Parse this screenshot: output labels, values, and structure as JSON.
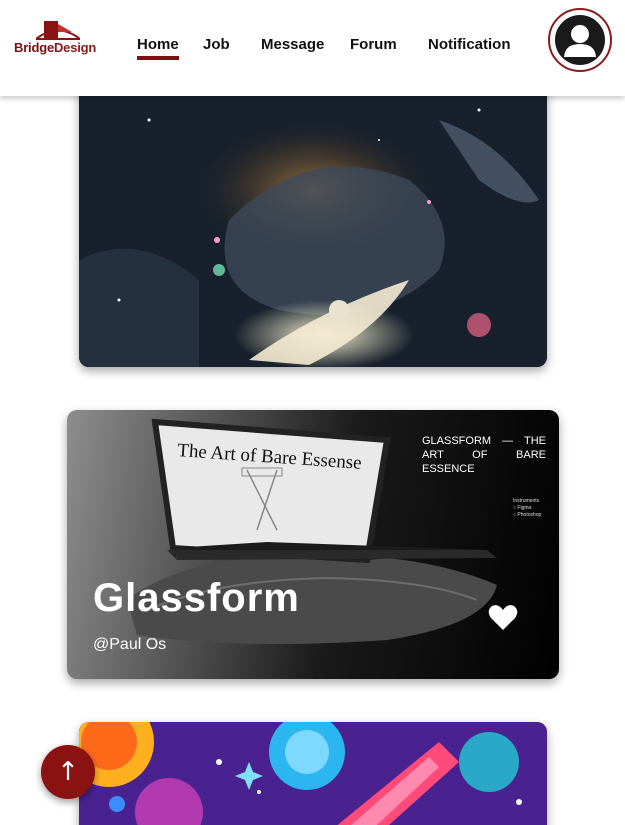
{
  "brand": {
    "name_part1": "Bridge",
    "name_part2": "Design"
  },
  "nav": {
    "items": [
      {
        "label": "Home",
        "active": true
      },
      {
        "label": "Job",
        "active": false
      },
      {
        "label": "Message",
        "active": false
      },
      {
        "label": "Forum",
        "active": false
      },
      {
        "label": "Notification",
        "active": false
      }
    ]
  },
  "header": {
    "avatar_icon": "user-icon"
  },
  "feed": {
    "cards": [
      {
        "title": "",
        "author": "",
        "image": "night-sky-whale-illustration"
      },
      {
        "title": "Glassform",
        "author": "@Paul Os",
        "image": "laptop-on-rock-mockup",
        "heading": "GLASSFORM — THE ART OF BARE ESSENCE",
        "screen_text": "The Art of Bare Essense",
        "instruments_label": "Instruments",
        "instruments": [
          "Figma",
          "Photoshop"
        ],
        "like_icon": "heart-icon"
      },
      {
        "title": "",
        "author": "",
        "image": "colorful-space-illustration"
      }
    ]
  },
  "scroll_top": {
    "label": "↑",
    "icon": "arrow-up-icon"
  },
  "colors": {
    "accent": "#8b1212",
    "nav_text": "#111111",
    "header_bg": "#ffffff"
  }
}
